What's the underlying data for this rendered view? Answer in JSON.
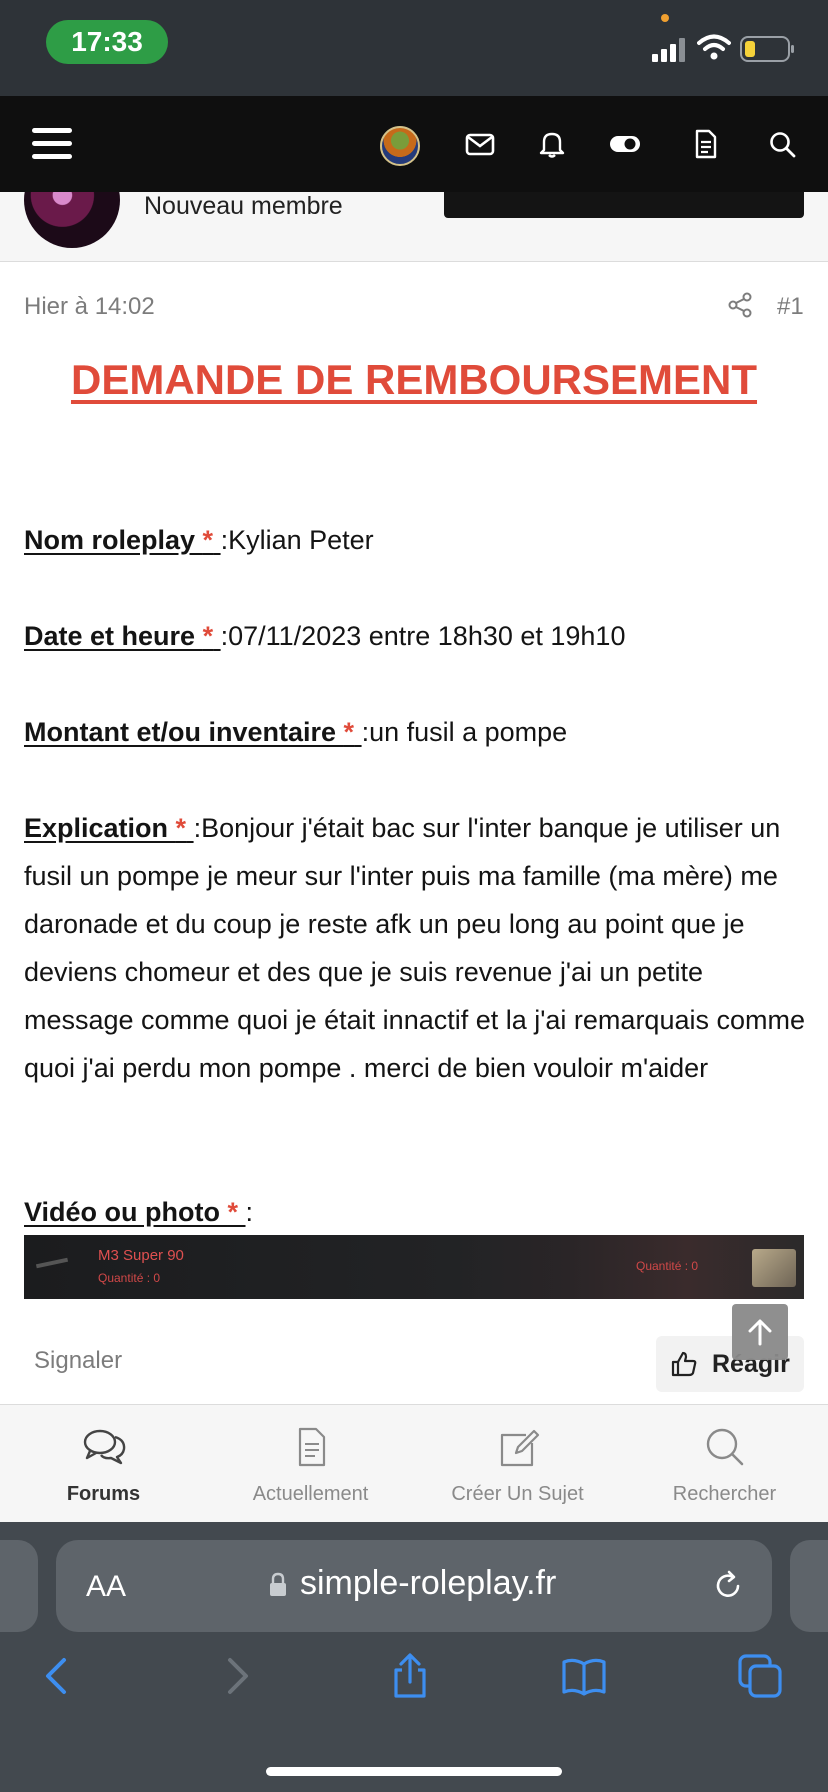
{
  "status_bar": {
    "time": "17:33"
  },
  "profile": {
    "user_title": "Nouveau membre"
  },
  "post": {
    "timestamp": "Hier à 14:02",
    "number": "#1",
    "heading": "DEMANDE DE REMBOURSEMENT",
    "required_marker": "*",
    "fields": [
      {
        "label": "Nom roleplay ",
        "separator": ":",
        "value": "Kylian Peter"
      },
      {
        "label": "Date et heure ",
        "separator": ":",
        "value": "07/11/2023 entre 18h30 et 19h10"
      },
      {
        "label": "Montant et/ou inventaire ",
        "separator": ":",
        "value": "un fusil a pompe"
      },
      {
        "label": "Explication ",
        "separator": ":",
        "value": "Bonjour j'était bac sur l'inter banque je utiliser un fusil un pompe je meur sur l'inter puis ma famille (ma mère) me daronade et du coup je reste afk un peu long au point que je deviens chomeur et des que je suis revenue j'ai un petite message comme quoi je était innactif et la j'ai remarquais comme quoi j'ai perdu mon pompe . merci de bien vouloir m'aider"
      },
      {
        "label": "Vidéo ou photo ",
        "separator": ":",
        "value": ""
      }
    ],
    "screenshot": {
      "item_name": "M3 Super 90",
      "quantity_left": "Quantité : 0",
      "quantity_right": "Quantité : 0"
    },
    "report_label": "Signaler",
    "react_label": "Réagir"
  },
  "tab_bar": {
    "tabs": [
      {
        "label": "Forums",
        "icon": "chat-bubbles-icon",
        "active": true
      },
      {
        "label": "Actuellement",
        "icon": "document-icon",
        "active": false
      },
      {
        "label": "Créer Un Sujet",
        "icon": "edit-icon",
        "active": false
      },
      {
        "label": "Rechercher",
        "icon": "search-icon",
        "active": false
      }
    ]
  },
  "browser": {
    "text_size_label": "AA",
    "url": "simple-roleplay.fr"
  },
  "colors": {
    "accent_red": "#e04b3a",
    "header_bg": "#0f0f0f",
    "status_green": "#2e9d46",
    "safari_blue": "#3d8ef0"
  }
}
